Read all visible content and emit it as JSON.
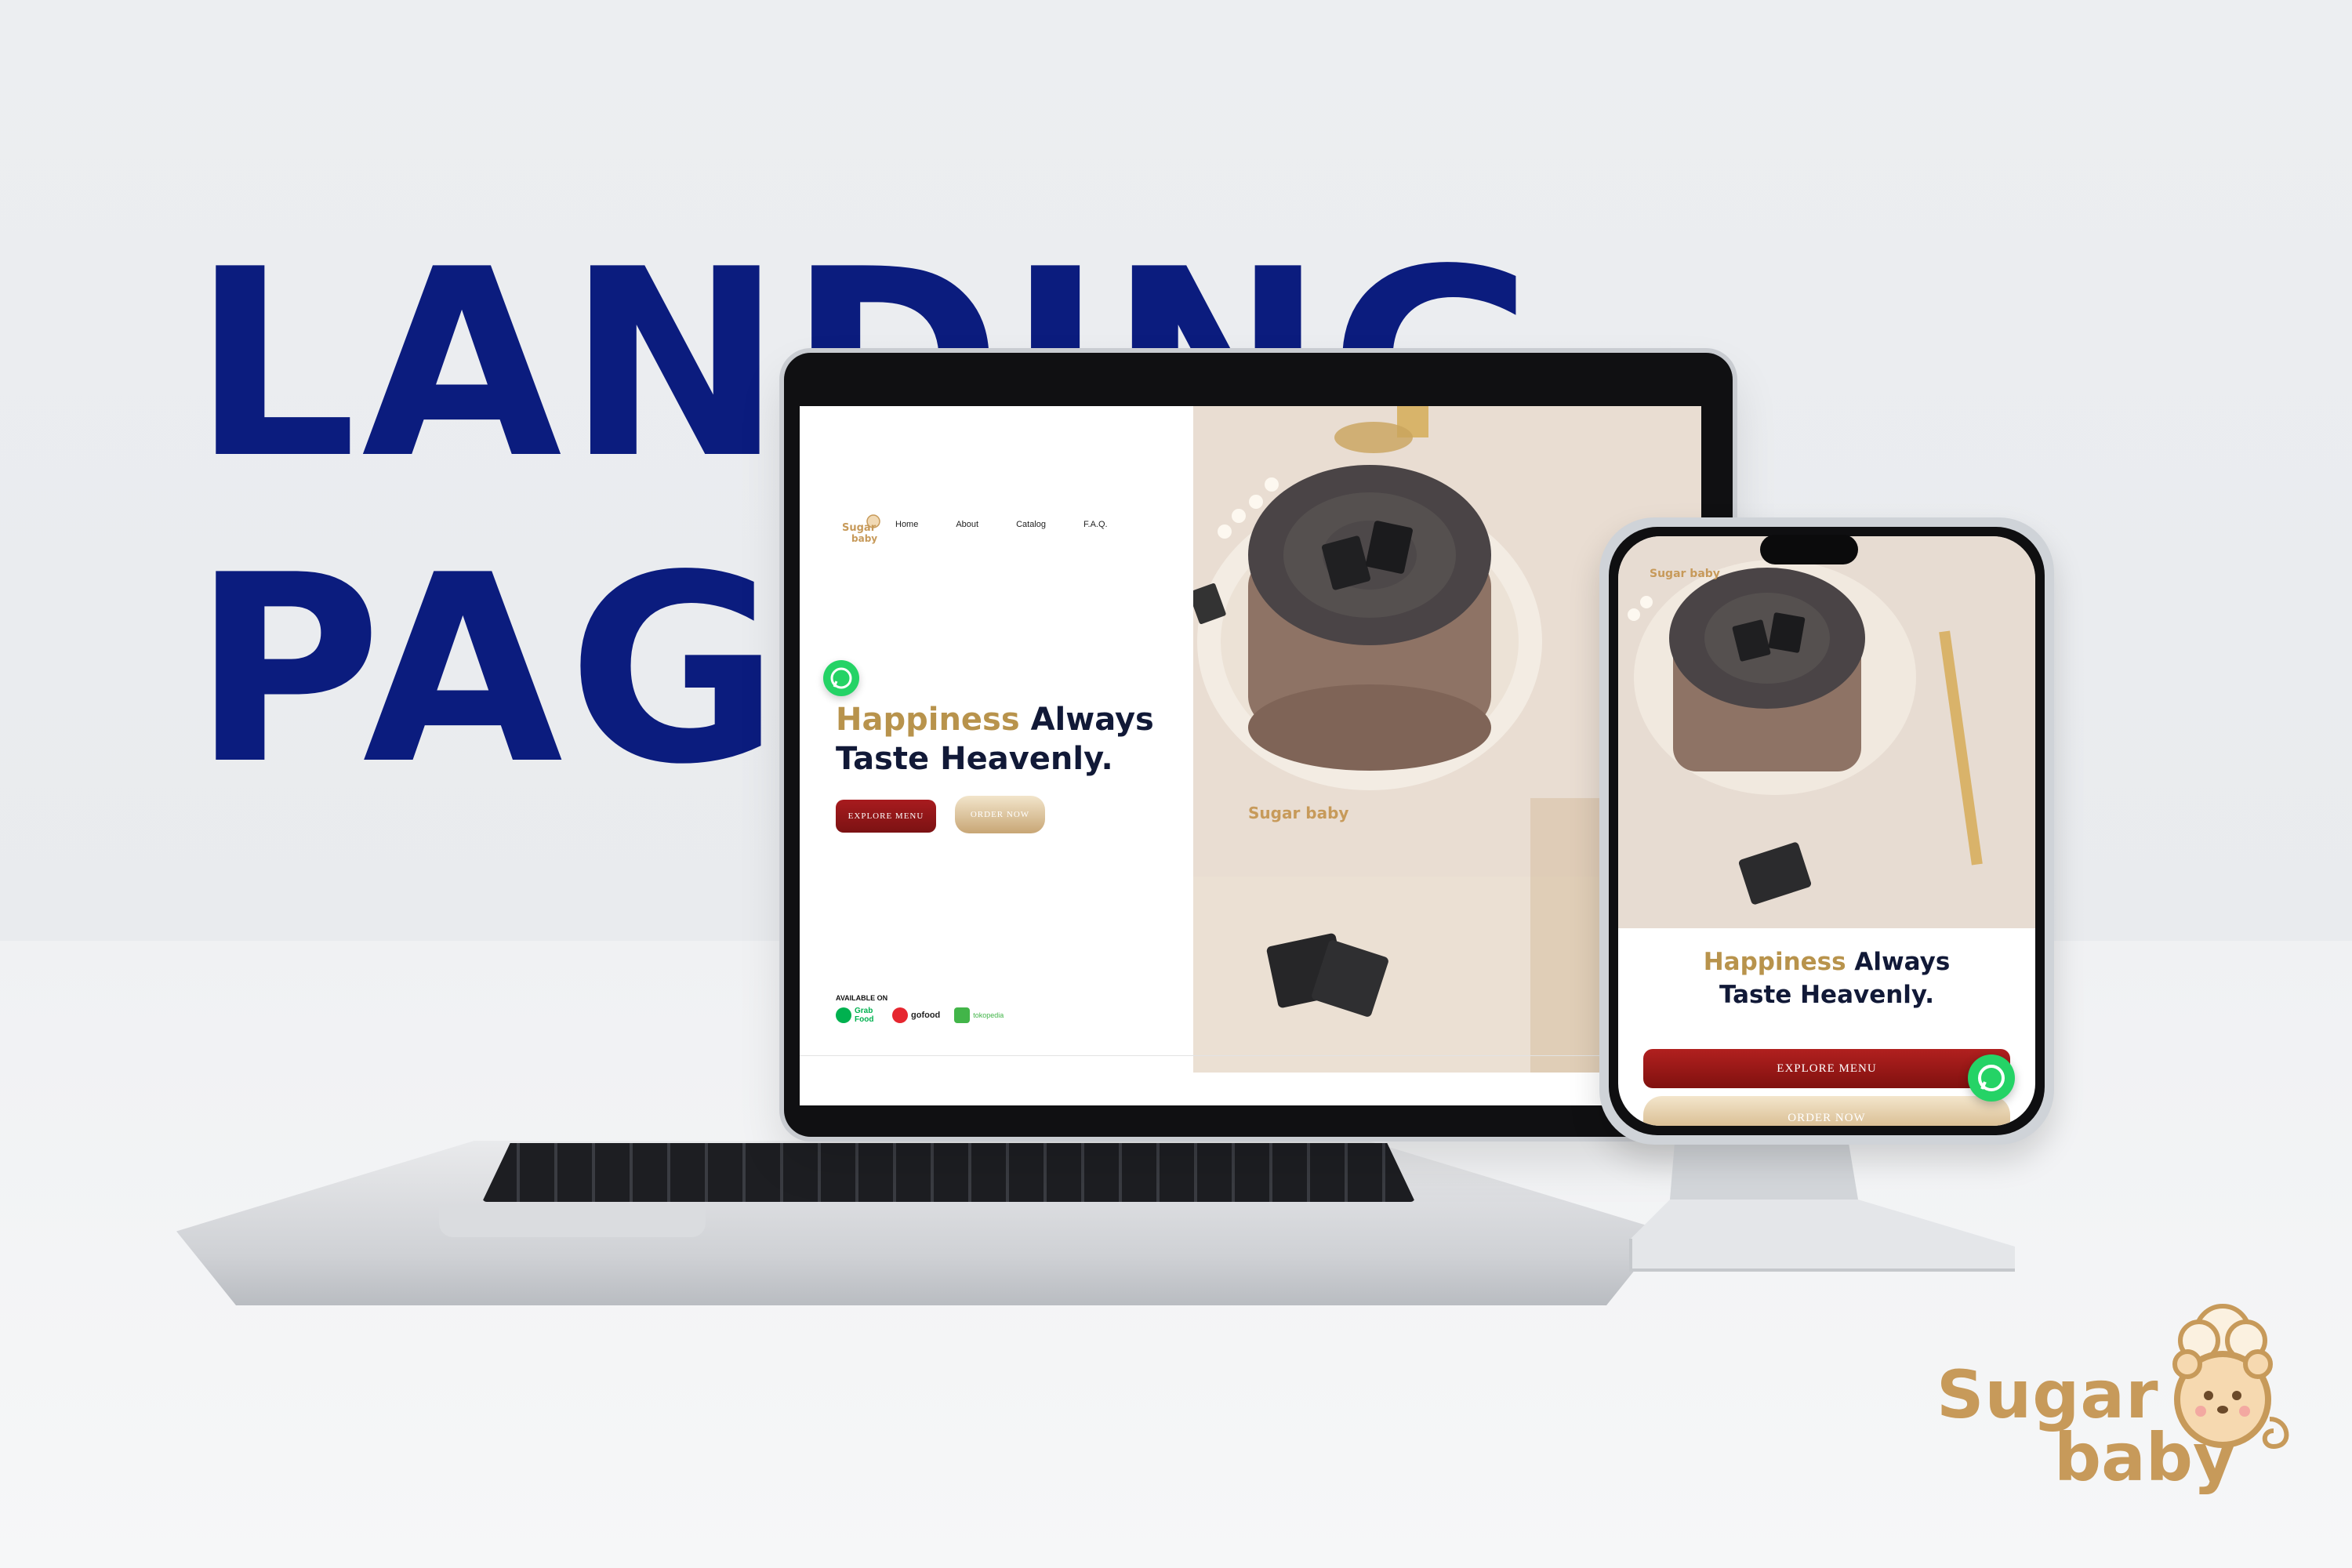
{
  "hero": {
    "line1": "LANDING",
    "line2": "PAG"
  },
  "laptop_site": {
    "logo_text": "Sugar baby",
    "nav": [
      "Home",
      "About",
      "Catalog",
      "F.A.Q."
    ],
    "headline_gold": "Happiness",
    "headline_rest_line1": " Always",
    "headline_line2": "Taste Heavenly.",
    "explore_label": "EXPLORE MENU",
    "order_label": "ORDER NOW",
    "available_label": "AVAILABLE ON",
    "partners": [
      "Grab Food",
      "gofood",
      "tokopedia"
    ],
    "photo_logo": "Sugar baby"
  },
  "phone_site": {
    "logo_text": "Sugar baby",
    "headline_gold": "Happiness",
    "headline_rest_line1": " Always",
    "headline_line2": "Taste Heavenly.",
    "explore_label": "EXPLORE MENU",
    "order_label": "ORDER NOW"
  },
  "brand": {
    "word1": "Sugar",
    "word2": "baby"
  },
  "colors": {
    "hero_blue": "#0b1c7e",
    "gold": "#b8934c",
    "navy_text": "#111937",
    "explore_red": "#a81b1e",
    "whatsapp_green": "#25d366",
    "brand_tan": "#c79a5a"
  },
  "icons": [
    "whatsapp-icon",
    "sugar-baby-bear-logo-icon",
    "grabfood-icon",
    "gofood-icon",
    "tokopedia-icon"
  ]
}
